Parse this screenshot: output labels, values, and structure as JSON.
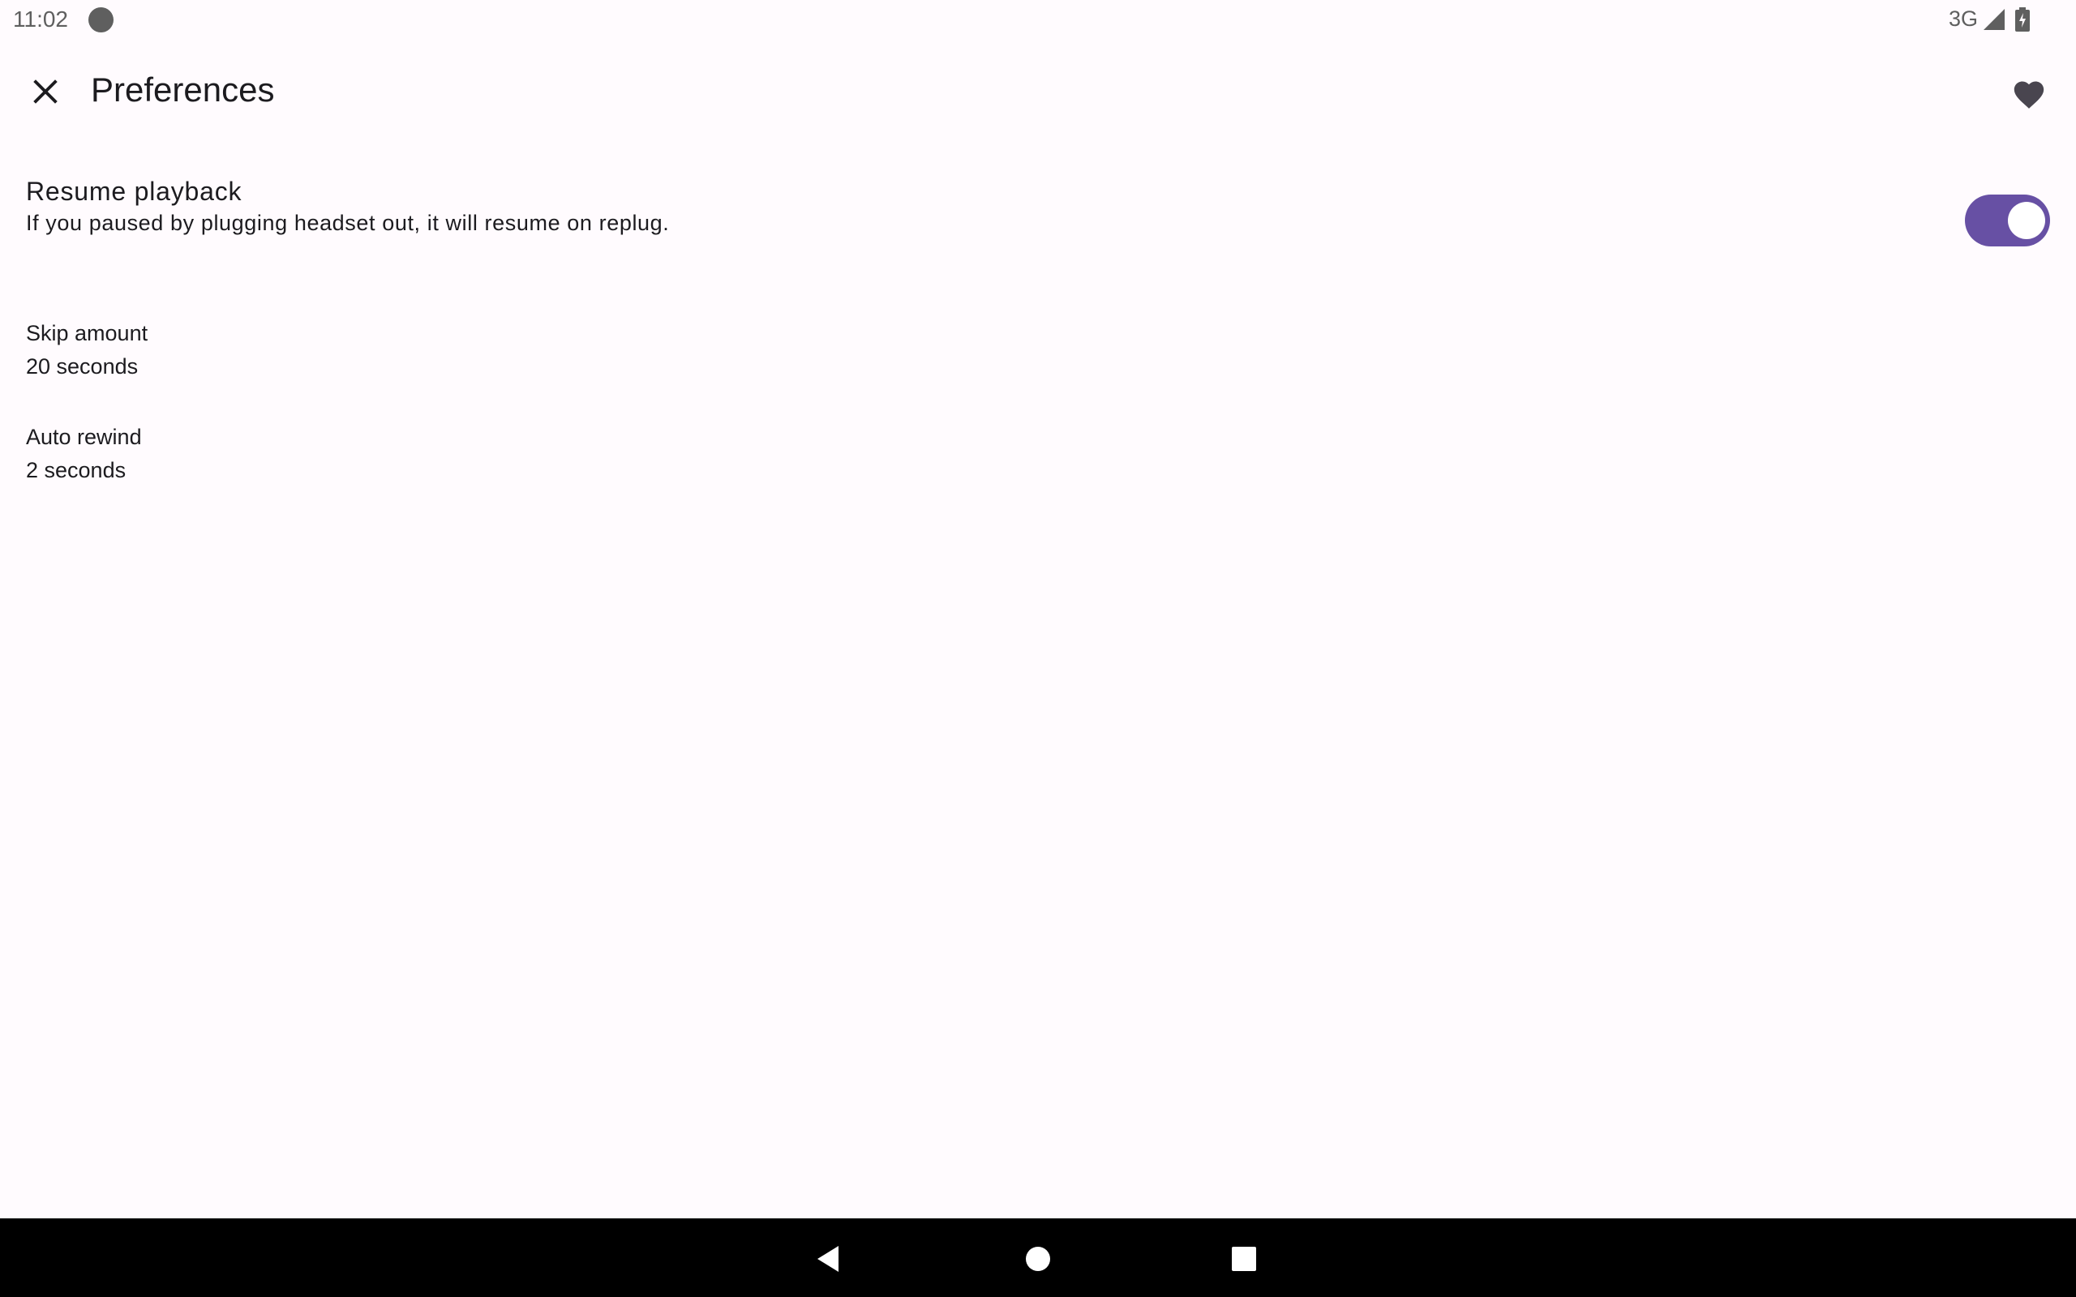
{
  "status_bar": {
    "time": "11:02",
    "network": "3G",
    "icons": [
      "notification-dot-icon",
      "signal-icon",
      "battery-icon"
    ]
  },
  "toolbar": {
    "title": "Preferences",
    "close_icon": "close-icon",
    "action_icon": "heart-icon"
  },
  "preferences": {
    "resume_playback": {
      "title": "Resume playback",
      "summary": "If you paused by plugging headset out, it will resume on replug.",
      "enabled": true
    },
    "skip_amount": {
      "title": "Skip amount",
      "summary": "20 seconds"
    },
    "auto_rewind": {
      "title": "Auto rewind",
      "summary": "2 seconds"
    }
  },
  "nav_bar": {
    "icons": [
      "back-icon",
      "home-icon",
      "recents-icon"
    ]
  },
  "colors": {
    "background": "#fffbfe",
    "accent": "#6750a4",
    "text": "#1c1b1f",
    "status_text": "#5f5f5f",
    "nav_bar": "#000000"
  }
}
